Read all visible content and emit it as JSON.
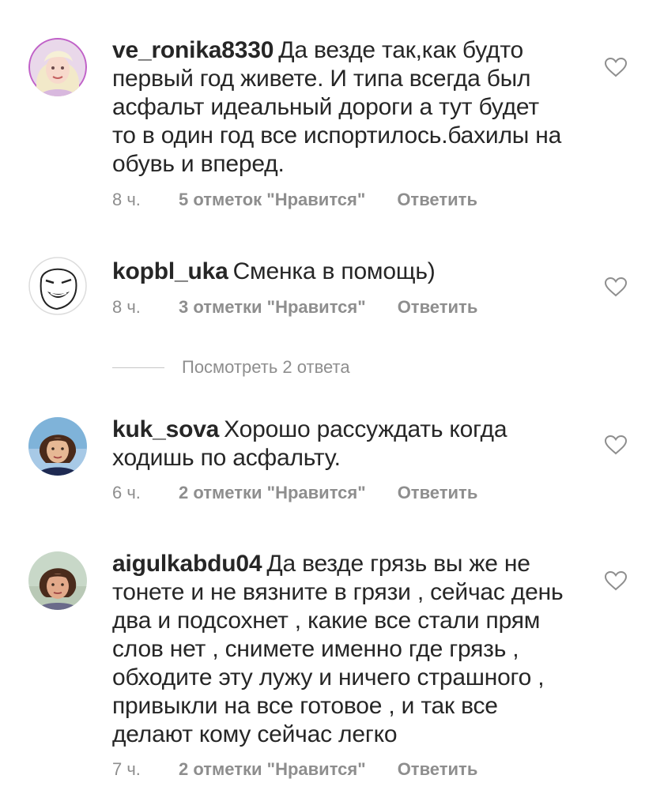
{
  "comments": [
    {
      "username": "ve_ronika8330",
      "text": "Да везде так,как будто первый год живете. И типа всегда был асфальт идеальный дороги а тут будет то  в один год все испортилось.бахилы на обувь и вперед.",
      "time": "8 ч.",
      "likes": "5 отметок \"Нравится\"",
      "reply": "Ответить",
      "avatar_icon": "avatar-blonde-woman",
      "heart_icon": "heart-outline-icon"
    },
    {
      "username": "kopbl_uka",
      "text": "Сменка в помощь)",
      "time": "8 ч.",
      "likes": "3 отметки \"Нравится\"",
      "reply": "Ответить",
      "avatar_icon": "avatar-meme-face",
      "heart_icon": "heart-outline-icon"
    },
    {
      "username": "kuk_sova",
      "text": "Хорошо рассуждать когда ходишь по асфальту.",
      "time": "6 ч.",
      "likes": "2 отметки \"Нравится\"",
      "reply": "Ответить",
      "avatar_icon": "avatar-woman-dark-hair",
      "heart_icon": "heart-outline-icon"
    },
    {
      "username": "aigulkabdu04",
      "text": "Да везде грязь вы же не тонете и не вязните в грязи ,  сейчас день два и подсохнет , какие все стали прям слов нет , снимете именно где грязь , обходите эту лужу и ничего страшного , привыкли на все готовое , и так все делают кому сейчас легко",
      "time": "7 ч.",
      "likes": "2 отметки \"Нравится\"",
      "reply": "Ответить",
      "avatar_icon": "avatar-woman-bob-hair",
      "heart_icon": "heart-outline-icon"
    }
  ],
  "view_replies": {
    "label": "Посмотреть 2 ответа"
  },
  "colors": {
    "text": "#262626",
    "secondary": "#8e8e8e",
    "divider": "#c7c7c7",
    "background": "#ffffff"
  }
}
